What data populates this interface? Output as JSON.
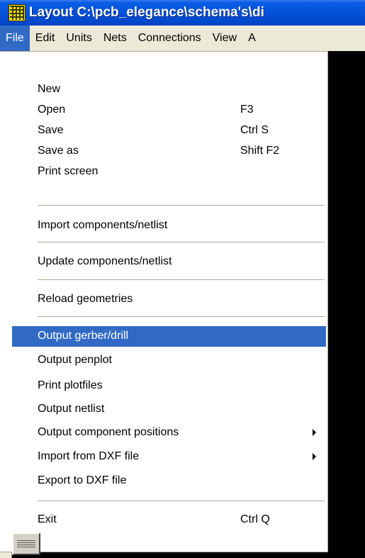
{
  "window": {
    "title": "Layout C:\\pcb_elegance\\schema's\\di",
    "icon": "layout-app-icon"
  },
  "menubar": {
    "items": [
      {
        "label": "File",
        "active": true
      },
      {
        "label": "Edit"
      },
      {
        "label": "Units"
      },
      {
        "label": "Nets"
      },
      {
        "label": "Connections"
      },
      {
        "label": "View"
      },
      {
        "label": "A"
      }
    ]
  },
  "file_menu": {
    "new": {
      "label": "New"
    },
    "open": {
      "label": "Open",
      "shortcut": "F3"
    },
    "save": {
      "label": "Save",
      "shortcut": "Ctrl S"
    },
    "save_as": {
      "label": "Save as",
      "shortcut": "Shift F2"
    },
    "print_screen": {
      "label": "Print screen"
    },
    "import_components": {
      "label": "Import components/netlist"
    },
    "update_components": {
      "label": "Update components/netlist"
    },
    "reload_geometries": {
      "label": "Reload geometries"
    },
    "output_gerber": {
      "label": "Output gerber/drill",
      "selected": true
    },
    "output_penplot": {
      "label": "Output penplot"
    },
    "print_plotfiles": {
      "label": "Print plotfiles"
    },
    "output_netlist": {
      "label": "Output netlist"
    },
    "output_component_positions": {
      "label": "Output component positions",
      "submenu": true
    },
    "import_dxf": {
      "label": "Import from DXF file",
      "submenu": true
    },
    "export_dxf": {
      "label": "Export to DXF file"
    },
    "exit": {
      "label": "Exit",
      "shortcut": "Ctrl Q"
    }
  },
  "colors": {
    "titlebar": "#0250d8",
    "menu_highlight": "#316ac5",
    "menubar_bg": "#ece9d8",
    "canvas_bg": "#000000"
  }
}
